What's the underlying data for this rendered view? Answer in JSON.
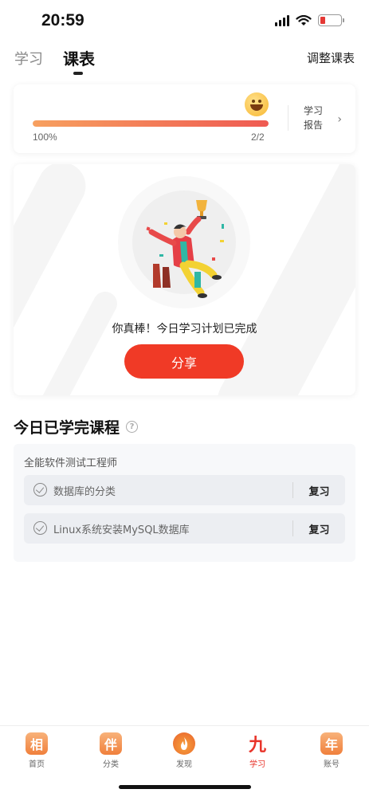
{
  "status_bar": {
    "time": "20:59",
    "icons": [
      "cellular-signal-icon",
      "wifi-icon",
      "battery-low-icon"
    ]
  },
  "header": {
    "tabs": [
      {
        "label": "学习",
        "active": false
      },
      {
        "label": "课表",
        "active": true
      }
    ],
    "adjust_label": "调整课表"
  },
  "progress": {
    "fraction": 1.0,
    "percent_label": "100%",
    "count_label": "2/2",
    "report_label": "学习报告",
    "emoji": "grinning-face-icon"
  },
  "success": {
    "message": "你真棒！今日学习计划已完成",
    "share_label": "分享",
    "illustration": "celebrating-person-trophy-illustration"
  },
  "completed": {
    "title": "今日已学完课程",
    "course_name": "全能软件测试工程师",
    "lessons": [
      {
        "title": "数据库的分类",
        "action": "复习"
      },
      {
        "title": "Linux系统安装MySQL数据库",
        "action": "复习"
      }
    ]
  },
  "bottom_nav": {
    "items": [
      {
        "label": "首页",
        "icon_char": "相",
        "active": false
      },
      {
        "label": "分类",
        "icon_char": "伴",
        "active": false
      },
      {
        "label": "发现",
        "icon_char": "",
        "active": false
      },
      {
        "label": "学习",
        "icon_char": "九",
        "active": true
      },
      {
        "label": "账号",
        "icon_char": "年",
        "active": false
      }
    ]
  },
  "colors": {
    "accent": "#f03a26",
    "progress_start": "#f7a05f",
    "progress_end": "#ef5a52",
    "active_nav": "#e8342a"
  }
}
